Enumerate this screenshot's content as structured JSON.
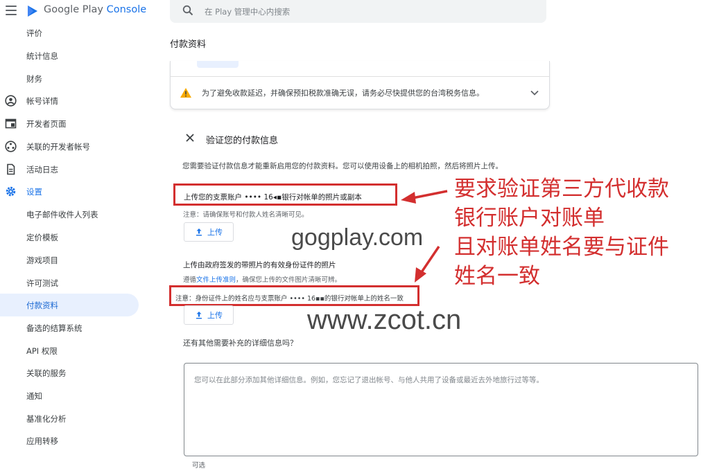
{
  "app": {
    "brand_prefix": "Google Play",
    "brand_suffix": "Console"
  },
  "sidebar": {
    "items": [
      {
        "label": "评价"
      },
      {
        "label": "统计信息"
      },
      {
        "label": "财务"
      },
      {
        "label": "帐号详情",
        "icon": "account-circle-icon"
      },
      {
        "label": "开发者页面",
        "icon": "web-page-icon"
      },
      {
        "label": "关联的开发者帐号",
        "icon": "linked-accounts-icon"
      },
      {
        "label": "活动日志",
        "icon": "document-icon"
      },
      {
        "label": "设置",
        "icon": "gear-icon"
      },
      {
        "label": "电子邮件收件人列表"
      },
      {
        "label": "定价模板"
      },
      {
        "label": "游戏项目"
      },
      {
        "label": "许可测试"
      },
      {
        "label": "付款资料"
      },
      {
        "label": "备选的结算系统"
      },
      {
        "label": "API 权限"
      },
      {
        "label": "关联的服务"
      },
      {
        "label": "通知"
      },
      {
        "label": "基准化分析"
      },
      {
        "label": "应用转移"
      }
    ]
  },
  "search": {
    "placeholder": "在 Play 管理中心内搜索"
  },
  "main": {
    "page_title": "付款资料",
    "warning_text": "为了避免收款延迟，并确保预扣税款准确无误，请务必尽快提供您的台湾税务信息。",
    "verify_title": "验证您的付款信息",
    "verify_desc": "您需要验证付款信息才能重新启用您的付款资料。您可以使用设备上的相机拍照，然后将照片上传。",
    "bank_label": "上传您的支票账户 •••• 16◂▪银行对帐单的照片或副本",
    "bank_note": "注意：请确保账号和付款人姓名清晰可见。",
    "upload_label": "上传",
    "id_title": "上传由政府签发的带照片的有效身份证件的照片",
    "id_rule_prefix": "遵循",
    "id_rule_link": "文件上传准则",
    "id_rule_suffix": "，确保您上传的文件图片清晰可辨。",
    "id_note": "注意：身份证件上的姓名应与支票账户 •••• 16▪▪的银行对帐单上的姓名一致",
    "extra_question": "还有其他需要补充的详细信息吗？",
    "extra_placeholder": "您可以在此部分添加其他详细信息。例如，您忘记了退出帐号、与他人共用了设备或最近去外地旅行过等等。",
    "optional_label": "可选"
  },
  "annotation": {
    "lines": [
      "要求验证第三方代收款",
      "银行账户对账单",
      "且对账单姓名要与证件",
      "姓名一致"
    ],
    "color": "#d32f2f"
  },
  "watermarks": {
    "top": "gogplay.com",
    "bottom": "www.zcot.cn"
  }
}
